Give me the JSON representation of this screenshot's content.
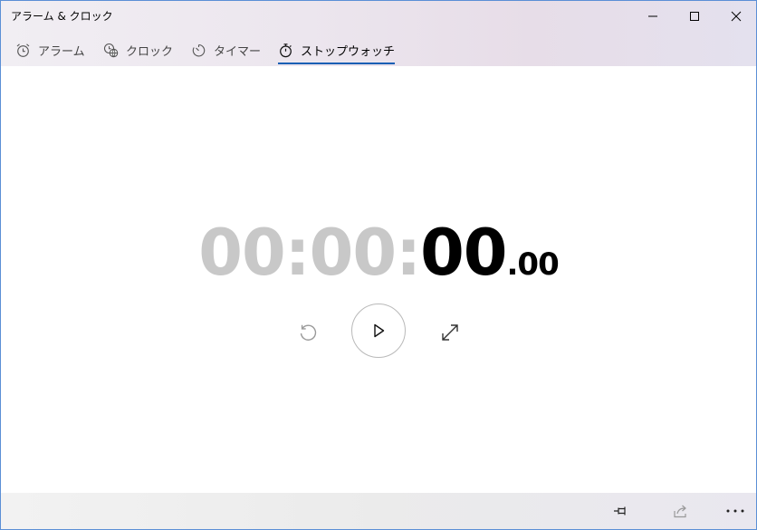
{
  "window": {
    "title": "アラーム & クロック"
  },
  "tabs": [
    {
      "label": "アラーム",
      "icon": "alarm-clock-icon",
      "active": false
    },
    {
      "label": "クロック",
      "icon": "world-clock-icon",
      "active": false
    },
    {
      "label": "タイマー",
      "icon": "timer-icon",
      "active": false
    },
    {
      "label": "ストップウォッチ",
      "icon": "stopwatch-icon",
      "active": true
    }
  ],
  "stopwatch": {
    "hours": "00",
    "sep1": ":",
    "minutes": "00",
    "sep2": ":",
    "seconds": "00",
    "fraction": ".00"
  },
  "controls": {
    "reset_icon": "reset-icon",
    "play_icon": "play-icon",
    "expand_icon": "expand-icon"
  },
  "bottom_bar": {
    "pin_icon": "pin-icon",
    "share_icon": "share-icon",
    "more_icon": "more-icon"
  },
  "colors": {
    "accent": "#1a5fb4",
    "dim_digits": "#c8c8c8"
  }
}
